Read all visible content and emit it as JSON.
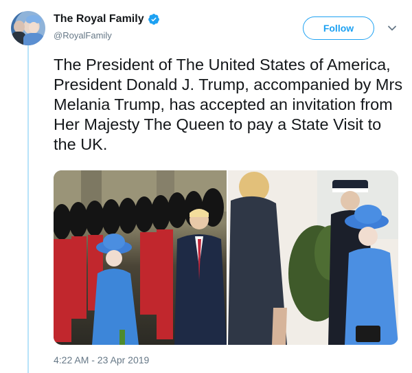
{
  "account": {
    "display_name": "The Royal Family",
    "handle": "@RoyalFamily",
    "verified": true
  },
  "actions": {
    "follow_label": "Follow"
  },
  "tweet": {
    "text": "The President of The United States of America, President Donald J. Trump, accompanied by Mrs Melania Trump, has accepted an invitation from Her Majesty The Queen to pay a State Visit to the UK.",
    "timestamp": "4:22 AM - 23 Apr 2019"
  },
  "media": {
    "photos": [
      "guards-inspection-photo",
      "greeting-photo"
    ]
  },
  "colors": {
    "accent": "#1da1f2",
    "thread_line": "#b7e3f9",
    "secondary_text": "#657786"
  }
}
